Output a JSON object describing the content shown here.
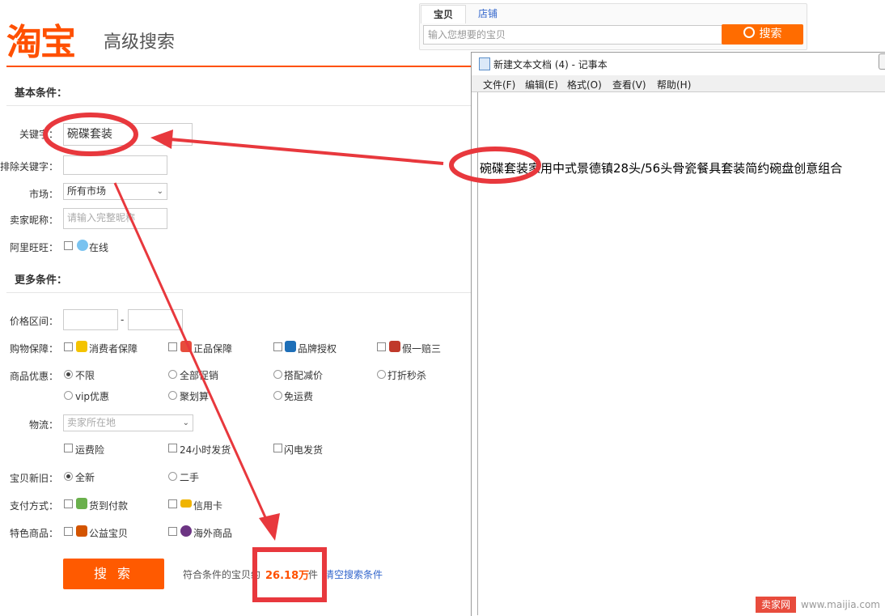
{
  "header": {
    "logo": "淘宝",
    "subtitle": "高级搜索",
    "tabs": [
      "宝贝",
      "店铺"
    ],
    "search_placeholder": "输入您想要的宝贝",
    "search_button": "搜索"
  },
  "form": {
    "basic_title": "基本条件：",
    "keyword_label": "关键字：",
    "keyword_value": "碗碟套装",
    "exclude_label": "排除关键字：",
    "market_label": "市场：",
    "market_value": "所有市场",
    "seller_label": "卖家昵称：",
    "seller_placeholder": "请输入完整昵称",
    "wangwang_label": "阿里旺旺：",
    "wangwang_online": "在线",
    "more_title": "更多条件：",
    "price_label": "价格区间：",
    "price_dash": "-",
    "guarantee_label": "购物保障：",
    "guarantee_options": [
      "消费者保障",
      "正品保障",
      "品牌授权",
      "假一赔三"
    ],
    "promo_label": "商品优惠：",
    "promo_options_row1": [
      "不限",
      "全部促销",
      "搭配减价",
      "打折秒杀"
    ],
    "promo_options_row2": [
      "vip优惠",
      "聚划算",
      "免运费"
    ],
    "logistics_label": "物流：",
    "logistics_placeholder": "卖家所在地",
    "logistics_options": [
      "运费险",
      "24小时发货",
      "闪电发货"
    ],
    "condition_label": "宝贝新旧：",
    "condition_options": [
      "全新",
      "二手"
    ],
    "payment_label": "支付方式：",
    "payment_options": [
      "货到付款",
      "信用卡"
    ],
    "special_label": "特色商品：",
    "special_options": [
      "公益宝贝",
      "海外商品"
    ],
    "submit": "搜 索",
    "result_prefix": "符合条件的宝贝约",
    "result_count": "26.18万",
    "result_unit": "件",
    "clear_link": "清空搜索条件"
  },
  "notepad": {
    "title": "新建文本文档 (4) - 记事本",
    "menu": [
      "文件(F)",
      "编辑(E)",
      "格式(O)",
      "查看(V)",
      "帮助(H)"
    ],
    "content": "碗碟套装家用中式景德镇28头/56头骨瓷餐具套装简约碗盘创意组合"
  },
  "watermark": {
    "badge": "卖家网",
    "url": "www.maijia.com"
  },
  "colors": {
    "brand": "#ff5000",
    "annotation": "#e8383d",
    "link": "#3366cc"
  }
}
